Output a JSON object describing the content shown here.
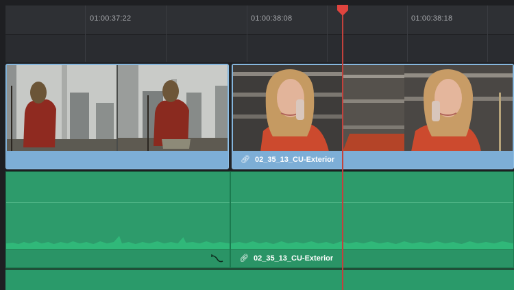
{
  "ruler": {
    "timecodes": [
      "01:00:37:22",
      "01:00:38:08",
      "01:00:38:18"
    ]
  },
  "tracks": {
    "video": {
      "clips": [
        {
          "name": ""
        },
        {
          "name": "02_35_13_CU-Exterior",
          "icon": "link-icon"
        }
      ]
    },
    "audio": {
      "clips": [
        {
          "name": "",
          "icon": "fade-curve-icon"
        },
        {
          "name": "02_35_13_CU-Exterior",
          "icon": "link-icon"
        }
      ]
    }
  },
  "colors": {
    "video_clip": "#7fb0d8",
    "audio_clip": "#2d9b6b",
    "playhead": "#e0443e"
  }
}
